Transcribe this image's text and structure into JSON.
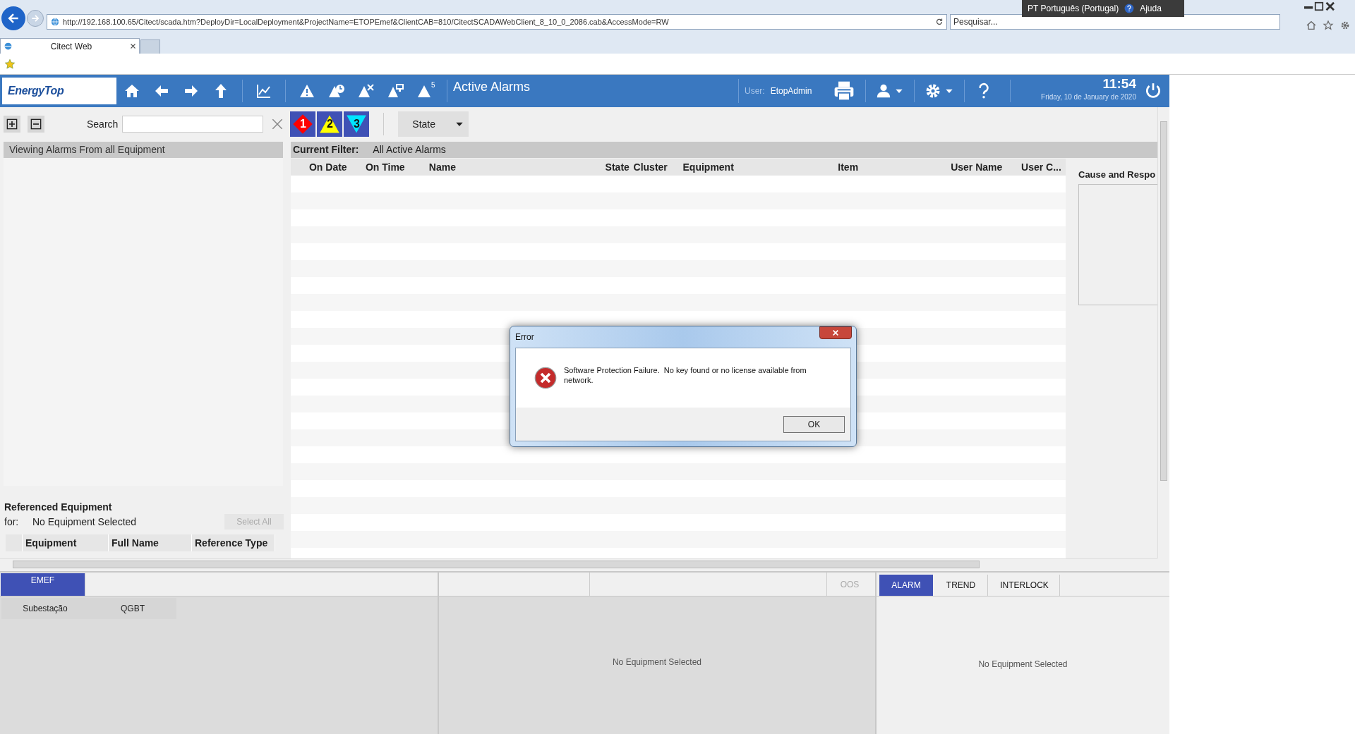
{
  "browser": {
    "address": "http://192.168.100.65/Citect/scada.htm?DeployDir=LocalDeployment&ProjectName=ETOPEmef&ClientCAB=810/CitectSCADAWebClient_8_10_0_2086.cab&AccessMode=RW",
    "search_placeholder": "Pesquisar...",
    "tabs": [
      {
        "label": "Citect Web",
        "selected": true
      }
    ],
    "language": "PT Português (Portugal)",
    "help": "Ajuda"
  },
  "app_bar": {
    "logo": "EnergyTop",
    "page_title": "Active Alarms",
    "user_label": "User:",
    "user": "EtopAdmin",
    "time": "11:54",
    "date": "Friday, 10 de January de 2020",
    "nav": [
      {
        "kind": "home"
      },
      {
        "kind": "back"
      },
      {
        "kind": "forward"
      },
      {
        "kind": "up"
      },
      {
        "kind": "trend"
      },
      {
        "kind": "alarm"
      },
      {
        "kind": "alarm_clock"
      },
      {
        "kind": "alarm_x"
      },
      {
        "kind": "alarm_monitor"
      },
      {
        "kind": "alarm_count",
        "badge": "5"
      }
    ]
  },
  "toolbar": {
    "search_label": "Search",
    "priorities": [
      {
        "label": "1",
        "color": "#ff0000"
      },
      {
        "label": "2",
        "color": "#ffff00"
      },
      {
        "label": "3",
        "color": "#00e5ff"
      }
    ],
    "state_dropdown": "State"
  },
  "left_panel": {
    "header": "Viewing Alarms From all Equipment",
    "referenced_title": "Referenced Equipment",
    "for_label": "for:",
    "for_value": "No Equipment Selected",
    "select_all": "Select All",
    "columns": [
      "Equipment",
      "Full Name",
      "Reference Type"
    ]
  },
  "alarm_table": {
    "filter_label": "Current Filter:",
    "filter_value": "All Active Alarms",
    "columns": [
      "On Date",
      "On Time",
      "Name",
      "State",
      "Cluster",
      "Equipment",
      "Item",
      "User Name",
      "User C..."
    ]
  },
  "cause_panel": {
    "title": "Cause and Respo"
  },
  "bottom": {
    "area_tabs": [
      {
        "label": "EMEF",
        "selected": true
      }
    ],
    "sub_items": [
      "Subestação",
      "QGBT"
    ],
    "middle_tab": "OOS",
    "middle_message": "No Equipment Selected",
    "right_tabs": [
      {
        "label": "ALARM",
        "selected": true
      },
      {
        "label": "TREND",
        "selected": false
      },
      {
        "label": "INTERLOCK",
        "selected": false
      }
    ],
    "right_message": "No Equipment Selected"
  },
  "dialog": {
    "title": "Error",
    "message": "Software Protection Failure.  No key found or no license available from network.",
    "button": "OK"
  }
}
